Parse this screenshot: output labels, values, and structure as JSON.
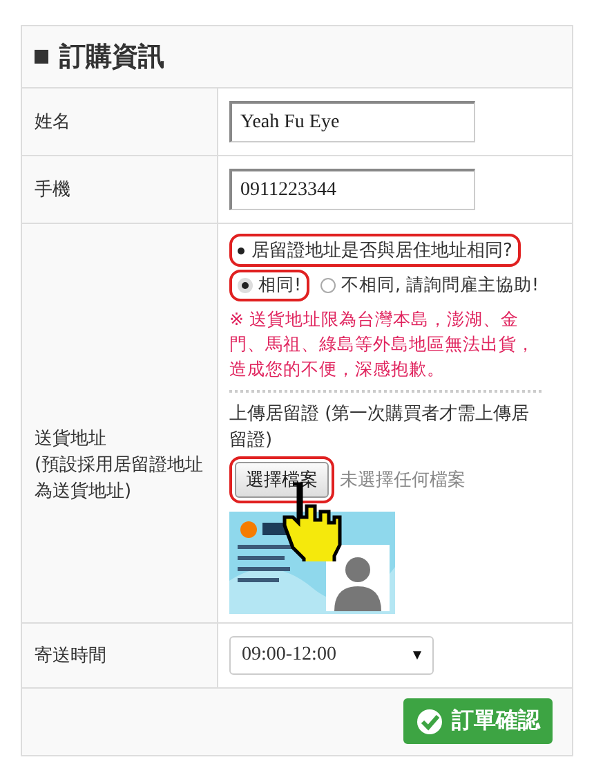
{
  "section": {
    "title": "訂購資訊"
  },
  "fields": [
    {
      "label": "姓名",
      "value": "Yeah Fu Eye"
    },
    {
      "label": "手機",
      "value": "0911223344"
    }
  ],
  "address": {
    "label": "送貨地址",
    "note": "(預設採用居留證地址為送貨地址)",
    "question": "居留證地址是否與居住地址相同?",
    "question_highlighted": true,
    "options": [
      {
        "label": "相同!",
        "selected": true,
        "highlighted": true
      },
      {
        "label": "不相同, 請詢問雇主協助!",
        "selected": false,
        "highlighted": false
      }
    ],
    "warning": "※ 送貨地址限為台灣本島，澎湖、金門、馬祖、綠島等外島地區無法出貨，造成您的不便，深感抱歉。",
    "upload_label": "上傳居留證 (第一次購買者才需上傳居留證)",
    "file_button": "選擇檔案",
    "file_button_highlighted": true,
    "file_status": "未選擇任何檔案"
  },
  "delivery": {
    "label": "寄送時間",
    "value": "09:00-12:00"
  },
  "submit": "訂單確認"
}
